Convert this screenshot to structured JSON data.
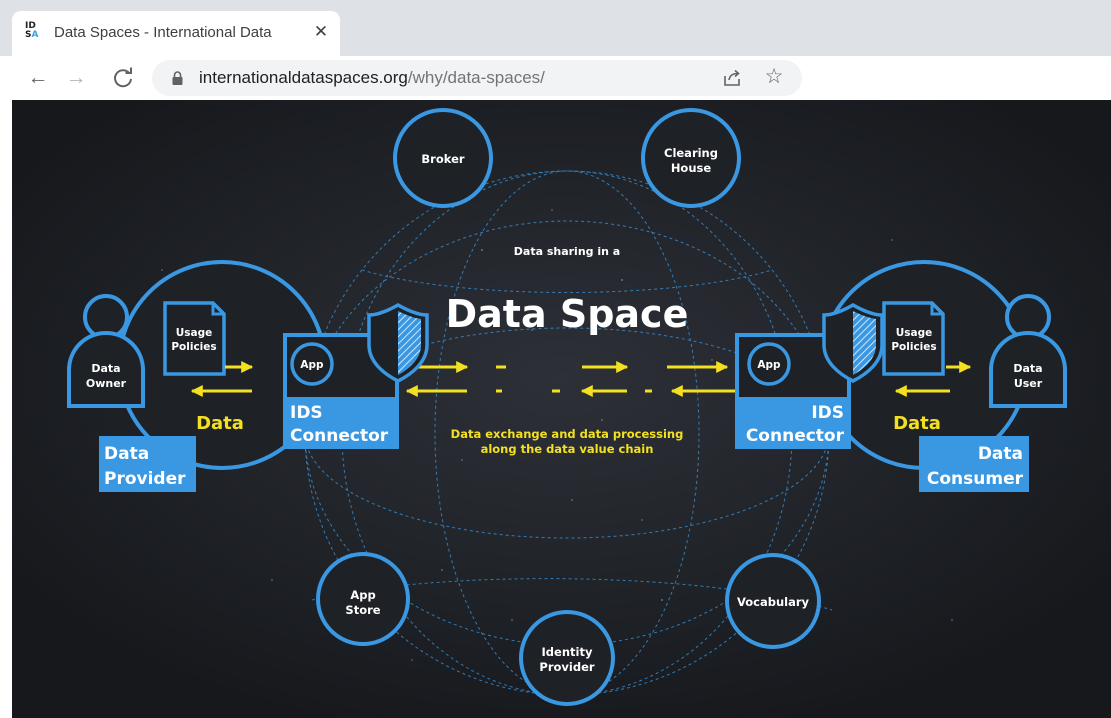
{
  "browser": {
    "tab": {
      "favicon_top": "ID",
      "favicon_bottom_s": "S",
      "favicon_bottom_a": "A",
      "title": "Data Spaces - International Data",
      "close_glyph": "✕"
    },
    "nav": {
      "back": "←",
      "forward": "→",
      "reload": "C"
    },
    "address": {
      "host": "internationaldataspaces.org",
      "path": "/why/data-spaces/"
    },
    "bookmark_glyph": "☆"
  },
  "diagram": {
    "colors": {
      "background": "#1a1d22",
      "accent_blue": "#3a98e3",
      "accent_yellow": "#f3e021",
      "text": "#ffffff"
    },
    "center": {
      "subtitle": "Data sharing in a",
      "title": "Data Space",
      "caption_line1": "Data exchange and data processing",
      "caption_line2": "along the data value chain"
    },
    "services": {
      "broker": "Broker",
      "clearing_line1": "Clearing",
      "clearing_line2": "House",
      "appstore_line1": "App",
      "appstore_line2": "Store",
      "identity_line1": "Identity",
      "identity_line2": "Provider",
      "vocabulary": "Vocabulary"
    },
    "provider": {
      "person_line1": "Data",
      "person_line2": "Owner",
      "doc_line1": "Usage",
      "doc_line2": "Policies",
      "data_label": "Data",
      "role_line1": "Data",
      "role_line2": "Provider",
      "app_label": "App",
      "connector_line1": "IDS",
      "connector_line2": "Connector"
    },
    "consumer": {
      "person_line1": "Data",
      "person_line2": "User",
      "doc_line1": "Usage",
      "doc_line2": "Policies",
      "data_label": "Data",
      "role_line1": "Data",
      "role_line2": "Consumer",
      "app_label": "App",
      "connector_line1": "IDS",
      "connector_line2": "Connector"
    }
  }
}
